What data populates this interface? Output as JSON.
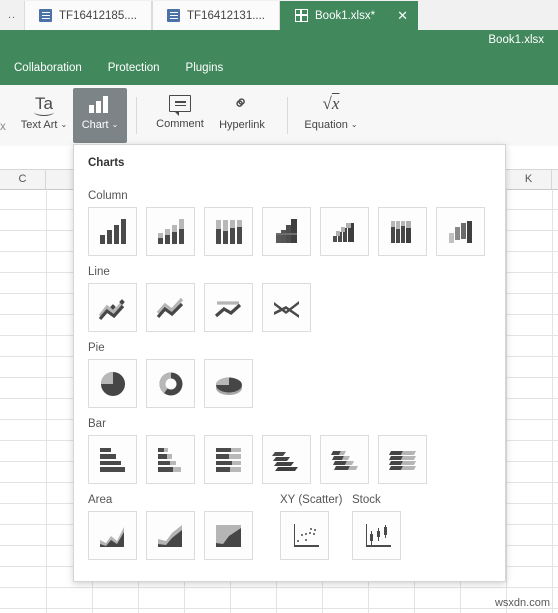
{
  "window": {
    "tab_overflow": "..",
    "tabs": [
      {
        "label": "TF16412185....",
        "icon": "document-icon",
        "active": false,
        "closable": false
      },
      {
        "label": "TF16412131....",
        "icon": "document-icon",
        "active": false,
        "closable": false
      },
      {
        "label": "Book1.xlsx*",
        "icon": "spreadsheet-grid-icon",
        "active": true,
        "closable": true,
        "close_label": "✕"
      }
    ]
  },
  "header": {
    "document_title": "Book1.xlsx",
    "accent_color": "#41895c",
    "menu": [
      {
        "label": "Collaboration"
      },
      {
        "label": "Protection"
      },
      {
        "label": "Plugins"
      }
    ]
  },
  "toolbar": {
    "partial_left_label": "x",
    "items": [
      {
        "label": "Text Art",
        "icon": "text-art-icon",
        "caret": "⌄",
        "active": false
      },
      {
        "label": "Chart",
        "icon": "chart-bars-icon",
        "caret": "⌄",
        "active": true
      },
      {
        "label": "Comment",
        "icon": "comment-icon",
        "caret": "",
        "active": false
      },
      {
        "label": "Hyperlink",
        "icon": "link-icon",
        "caret": "",
        "active": false
      },
      {
        "label": "Equation",
        "icon": "equation-icon",
        "caret": "⌄",
        "active": false
      }
    ],
    "text_art_glyph": "Ta",
    "link_glyph": "⚭",
    "equation_glyph": "√x"
  },
  "sheet": {
    "visible_column_headers": [
      "C",
      "K"
    ],
    "col_c_label": "C",
    "col_k_label": "K"
  },
  "chart_panel": {
    "title": "Charts",
    "groups": [
      {
        "label": "Column",
        "items": [
          {
            "name": "clustered-column"
          },
          {
            "name": "stacked-column"
          },
          {
            "name": "100-percent-stacked-column"
          },
          {
            "name": "3d-clustered-column"
          },
          {
            "name": "3d-stacked-column"
          },
          {
            "name": "3d-100-percent-stacked-column"
          },
          {
            "name": "3d-column"
          }
        ]
      },
      {
        "label": "Line",
        "items": [
          {
            "name": "line-with-markers"
          },
          {
            "name": "stacked-line"
          },
          {
            "name": "100-percent-stacked-line"
          },
          {
            "name": "3d-line"
          }
        ]
      },
      {
        "label": "Pie",
        "items": [
          {
            "name": "pie"
          },
          {
            "name": "doughnut"
          },
          {
            "name": "3d-pie"
          }
        ]
      },
      {
        "label": "Bar",
        "items": [
          {
            "name": "clustered-bar"
          },
          {
            "name": "stacked-bar"
          },
          {
            "name": "100-percent-stacked-bar"
          },
          {
            "name": "3d-clustered-bar"
          },
          {
            "name": "3d-stacked-bar"
          },
          {
            "name": "3d-100-percent-stacked-bar"
          }
        ]
      },
      {
        "label": "Area",
        "items": [
          {
            "name": "area"
          },
          {
            "name": "stacked-area"
          },
          {
            "name": "100-percent-stacked-area"
          }
        ]
      },
      {
        "label": "XY (Scatter)",
        "items": [
          {
            "name": "scatter"
          }
        ]
      },
      {
        "label": "Stock",
        "items": [
          {
            "name": "stock"
          }
        ]
      }
    ]
  },
  "watermark": {
    "text": "wsxdn.com"
  }
}
